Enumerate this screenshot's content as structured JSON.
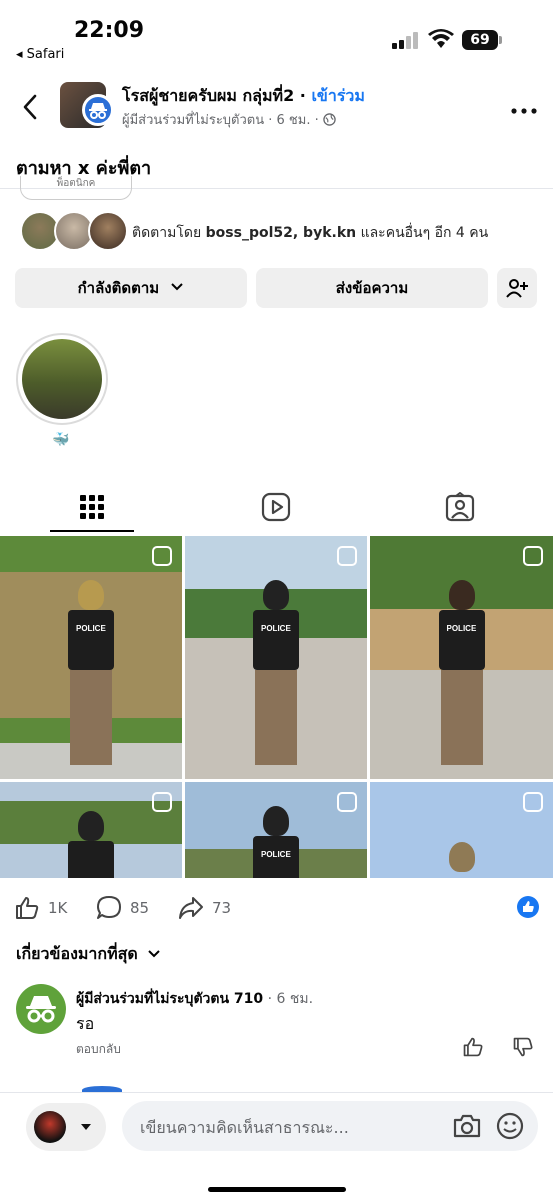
{
  "status_bar": {
    "time": "22:09",
    "back_app": "◂ Safari",
    "battery": "69"
  },
  "header": {
    "group_name": "โรสผู้ชายครับผม กลุ่มที่2",
    "separator": " · ",
    "join_label": "เข้าร่วม",
    "author": "ผู้มีส่วนร่วมที่ไม่ระบุตัวตน",
    "post_time": "6 ชม.",
    "privacy_icon": "globe-icon"
  },
  "post": {
    "title": "ตามหา x ค่ะพี่ตา",
    "cut_chip": "พ็อตนิกค"
  },
  "profile": {
    "followed_by_prefix": "ติดตามโดย ",
    "followed_by_names": "boss_pol52, byk.kn",
    "followed_by_suffix": " และคนอื่นๆ อีก 4 คน",
    "following_label": "กำลังติดตาม",
    "message_label": "ส่งข้อความ",
    "highlight_label": "🐳"
  },
  "posts_grid": {
    "badge_text": "POLICE"
  },
  "reactions": {
    "likes": "1K",
    "comments": "85",
    "shares": "73"
  },
  "comments_section": {
    "sort_label": "เกี่ยวข้องมากที่สุด",
    "comment_author": "ผู้มีส่วนร่วมที่ไม่ระบุตัวตน 710",
    "comment_time": " · 6 ชม.",
    "comment_body": "รอ",
    "reply_label": "ตอบกลับ"
  },
  "composer": {
    "placeholder": "เขียนความคิดเห็นสาธารณะ..."
  },
  "colors": {
    "accent": "#1877f2",
    "secondary_text": "#65676b",
    "button_bg": "#efefef"
  }
}
